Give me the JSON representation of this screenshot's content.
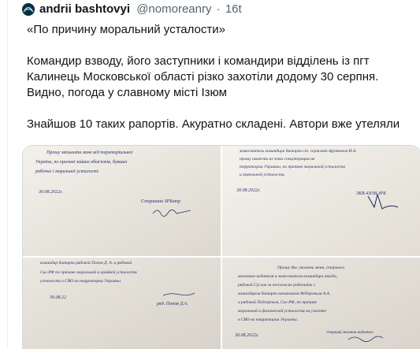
{
  "tweet": {
    "author_name": "andrii bashtovyi",
    "handle": "@nomoreanry",
    "separator": "·",
    "time": "16t",
    "lines": [
      "«По причину моральний усталости»",
      "",
      "Командир взводу, його заступники і командири відділень із пгт",
      "Калинець Московської області різко захотіли додому 30 серпня.",
      "Видно, погода у славному місті Ізюм",
      "",
      "Знайшов 10 таких рапортів. Акуратно складені. Автори вже утеляли"
    ]
  },
  "media": {
    "photo_1": {
      "lines": [
        "Прошу звільнити мене від територіальної",
        "України, по причині зайвих обов'язків, бувших",
        "рабочих і моральної усталості.",
        "",
        "Старшина ЗРБатр",
        "30.08.2022г."
      ],
      "date": "30.08.2022г.",
      "signature_caption": "Старшина ЗРБатр"
    },
    "photo_2": {
      "lines": [
        "заместитель командира батареи ст. сержант Арутюнов И.А.",
        "прошу вывести из зоны спецоперации на",
        "территории Украины, по причине моральной усталости",
        "и моральной усталости."
      ],
      "date": "30.08.2022г.",
      "signature_caption": "3КВ 43ОВ ЗРБ"
    },
    "photo_3": {
      "lines": [
        "командир батареи рядовой Попов Д. А. и рядовой",
        "Сил РФ по причине моральной и крайней усталости",
        "усталости в СВО на территории Украины."
      ],
      "date": "30.08.22",
      "signature_caption": "ряд. Попов Д.А."
    },
    "photo_4": {
      "lines": [
        "Прошу Вас уволить меня, старшего",
        "механика-водителя и заместителя командира взвода,",
        "рядовой Суслов за несогласие работать с",
        "командиром батареи капитаном Фёдоровым А.А.",
        "и рядовой Подгорным, Сил РФ, по причине",
        "моральной и физической усталости на участке",
        "в СВО на территории Украины."
      ],
      "date": "30.08.2022г.",
      "signature_caption": "старший механик-водитель"
    }
  },
  "colors": {
    "paper": "#ece8df",
    "ink": "#2a2f6e",
    "border": "#cfd9de",
    "muted": "#536471"
  }
}
